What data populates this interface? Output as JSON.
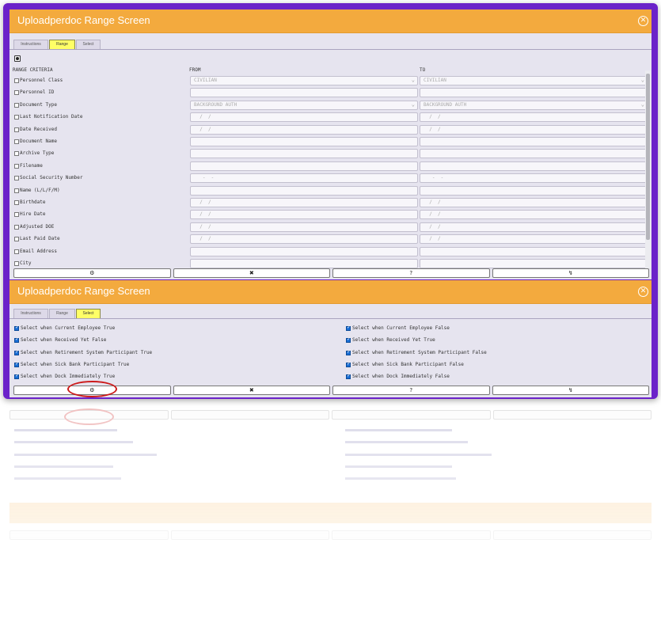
{
  "panel1": {
    "title": "Uploadperdoc Range Screen",
    "tabs": [
      "Instructions",
      "Range",
      "Select"
    ],
    "active_tab": "Range",
    "headers": {
      "criteria": "RANGE CRITERIA",
      "from": "FROM",
      "to": "TO"
    },
    "rows": [
      {
        "label": "Personnel Class",
        "from": "CIVILIAN",
        "to": "CIVILIAN"
      },
      {
        "label": "Personnel ID",
        "from": "",
        "to": ""
      },
      {
        "label": "Document Type",
        "from": "BACKGROUND AUTH",
        "to": "BACKGROUND AUTH"
      },
      {
        "label": "Last Notification Date",
        "from": "  /  /",
        "to": "  /  /"
      },
      {
        "label": "Date Received",
        "from": "  /  /",
        "to": "  /  /"
      },
      {
        "label": "Document Name",
        "from": "",
        "to": ""
      },
      {
        "label": "Archive Type",
        "from": "",
        "to": ""
      },
      {
        "label": "Filename",
        "from": "",
        "to": ""
      },
      {
        "label": "Social Security Number",
        "from": "   -  -",
        "to": "   -  -"
      },
      {
        "label": "Name (L/L/F/M)",
        "from": "",
        "to": ""
      },
      {
        "label": "Birthdate",
        "from": "  /  /",
        "to": "  /  /"
      },
      {
        "label": "Hire Date",
        "from": "  /  /",
        "to": "  /  /"
      },
      {
        "label": "Adjusted DOE",
        "from": "  /  /",
        "to": "  /  /"
      },
      {
        "label": "Last Paid Date",
        "from": "  /  /",
        "to": "  /  /"
      },
      {
        "label": "Email Address",
        "from": "",
        "to": ""
      },
      {
        "label": "City",
        "from": "",
        "to": ""
      }
    ],
    "buttons": [
      "⚙",
      "✖",
      "?",
      "↯"
    ]
  },
  "panel2": {
    "title": "Uploadperdoc Range Screen",
    "tabs": [
      "Instructions",
      "Range",
      "Select"
    ],
    "active_tab": "Select",
    "left": [
      "Select when Current Employee True",
      "Select when Received Yet False",
      "Select when Retirement System Participant True",
      "Select when Sick Bank Participant True",
      "Select when Dock Immediately True"
    ],
    "right": [
      "Select when Current Employee False",
      "Select when Received Yet True",
      "Select when Retirement System Participant False",
      "Select when Sick Bank Participant False",
      "Select when Dock Immediately False"
    ],
    "buttons": [
      "⚙",
      "✖",
      "?",
      "↯"
    ]
  },
  "colors": {
    "frame": "#6b22c9",
    "header": "#f3aa3e",
    "active_tab": "#ffff66",
    "panel": "#e6e4ef",
    "highlight": "#cc1a1a"
  },
  "icons": [
    "settings-icon",
    "cancel-icon",
    "help-icon",
    "export-icon",
    "close-icon"
  ]
}
